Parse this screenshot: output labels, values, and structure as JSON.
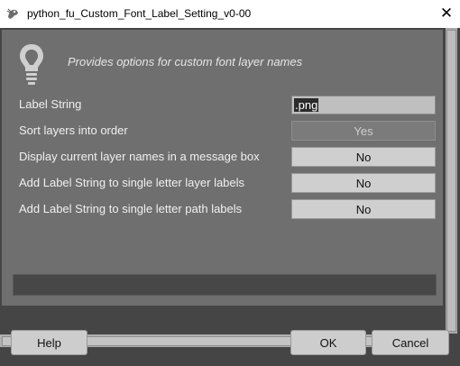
{
  "window": {
    "title": "python_fu_Custom_Font_Label_Setting_v0-00",
    "close_glyph": "✕"
  },
  "header": {
    "description": "Provides options for custom font layer names",
    "icon": "lightbulb-icon"
  },
  "form": {
    "label_string": {
      "label": "Label String",
      "value": ".png"
    },
    "sort_layers": {
      "label": "Sort layers into order",
      "value": "Yes"
    },
    "display_names": {
      "label": "Display current layer names in a message box",
      "value": "No"
    },
    "add_letter_layer": {
      "label": "Add Label String to single letter layer labels",
      "value": "No"
    },
    "add_letter_path": {
      "label": "Add Label String to single letter path labels",
      "value": "No"
    }
  },
  "buttons": {
    "help": "Help",
    "ok": "OK",
    "cancel": "Cancel"
  },
  "colors": {
    "background": "#454545",
    "panel": "#6f6f6f",
    "button": "#cdcdcd"
  }
}
